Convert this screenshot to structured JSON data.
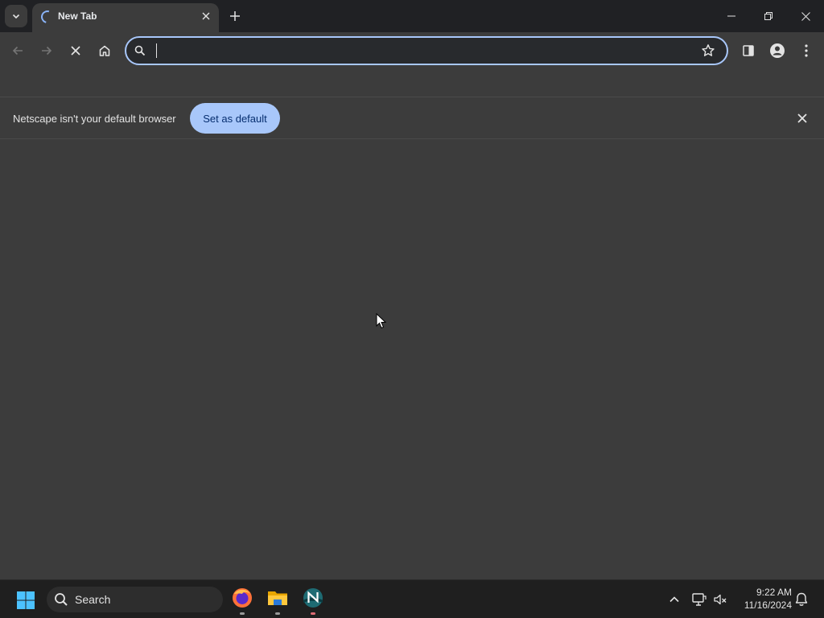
{
  "browser": {
    "tab": {
      "title": "New Tab"
    },
    "omnibox": {
      "value": "",
      "placeholder": ""
    },
    "infobar": {
      "message": "Netscape isn't your default browser",
      "button_label": "Set as default"
    }
  },
  "taskbar": {
    "search_label": "Search",
    "clock": {
      "time": "9:22 AM",
      "date": "11/16/2024"
    },
    "apps": [
      "firefox",
      "file-explorer",
      "netscape"
    ]
  },
  "colors": {
    "accent": "#a8c7fa",
    "frame": "#202124",
    "toolbar": "#3c3c3c",
    "taskbar": "#1f1f1f"
  }
}
